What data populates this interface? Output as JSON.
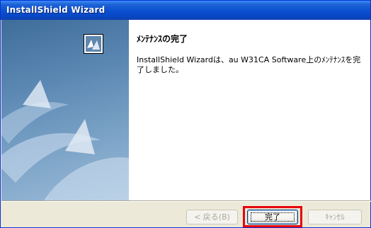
{
  "window": {
    "title": "InstallShield Wizard"
  },
  "content": {
    "heading": "ﾒﾝﾃﾅﾝｽの完了",
    "message": "InstallShield Wizardは、au W31CA Software上のﾒﾝﾃﾅﾝｽを完了しました。"
  },
  "buttons": {
    "back": "< 戻る(B)",
    "finish": "完了",
    "cancel": "ｷｬﾝｾﾙ"
  },
  "colors": {
    "highlight": "#e8000c",
    "titlebar": "#0a4fd0"
  }
}
